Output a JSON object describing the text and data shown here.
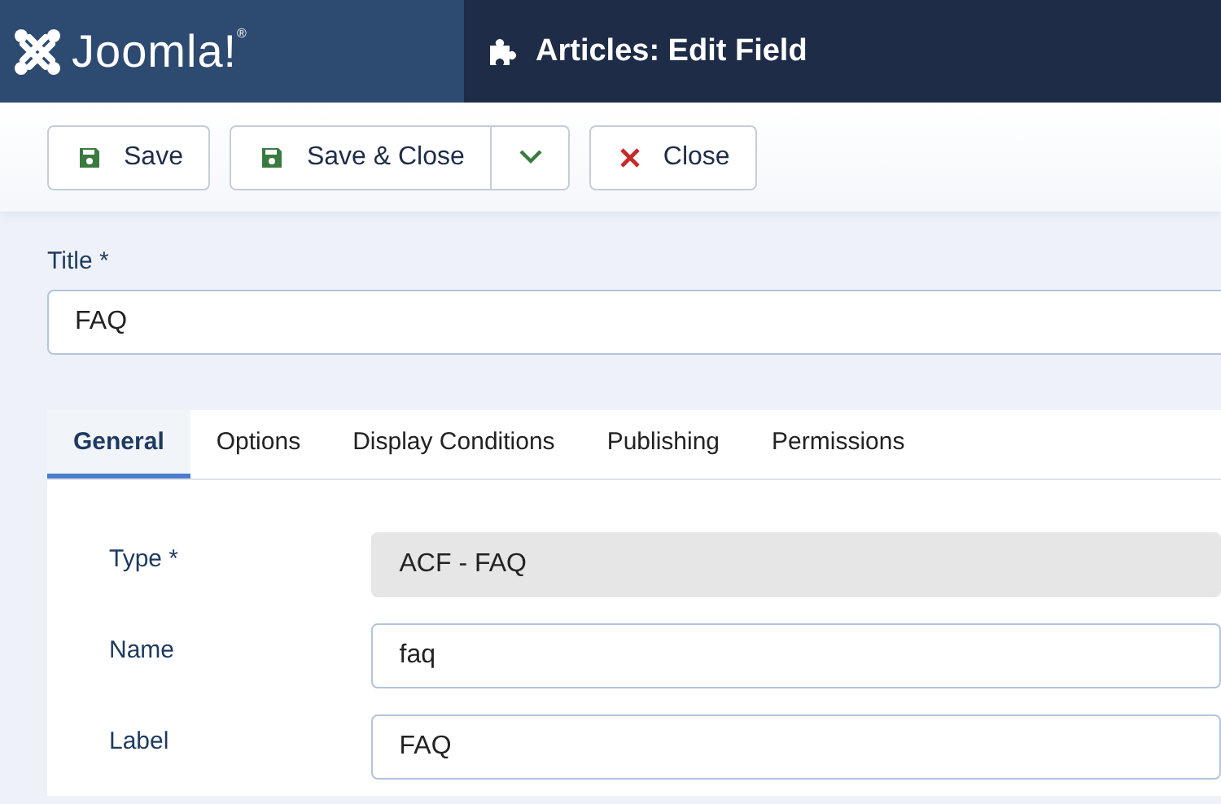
{
  "header": {
    "logo_text": "Joomla!",
    "logo_mark": "®",
    "title": "Articles: Edit Field"
  },
  "toolbar": {
    "buttons": [
      {
        "label": "Save",
        "kind": "save"
      },
      {
        "label": "Save & Close",
        "kind": "save-close"
      },
      {
        "label": "Close",
        "kind": "close"
      }
    ]
  },
  "title_field": {
    "label": "Title *",
    "value": "FAQ"
  },
  "tabs": [
    {
      "label": "General",
      "selected": true
    },
    {
      "label": "Options",
      "selected": false
    },
    {
      "label": "Display Conditions",
      "selected": false
    },
    {
      "label": "Publishing",
      "selected": false
    },
    {
      "label": "Permissions",
      "selected": false
    }
  ],
  "fields": [
    {
      "label": "Type *",
      "value": "ACF - FAQ",
      "disabled": true
    },
    {
      "label": "Name",
      "value": "faq",
      "disabled": false
    },
    {
      "label": "Label",
      "value": "FAQ",
      "disabled": false
    }
  ]
}
